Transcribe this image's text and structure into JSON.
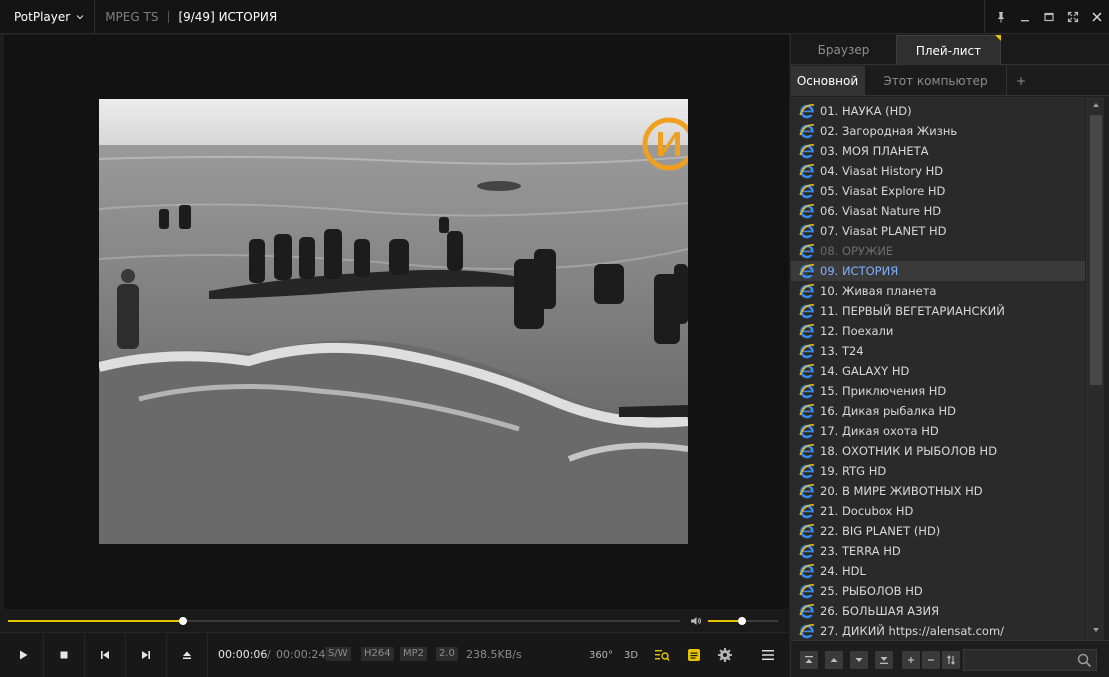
{
  "titlebar": {
    "app_name": "PotPlayer",
    "format": "MPEG TS",
    "title": "[9/49] ИСТОРИЯ"
  },
  "playback": {
    "current_time": "00:00:06",
    "separator": "/",
    "total_time": "00:00:24",
    "seek_fraction": 0.26,
    "volume_fraction": 0.48
  },
  "codec_badges": [
    "S/W",
    "H264",
    "MP2",
    "2.0"
  ],
  "bitrate": "238.5KB/s",
  "toolbar_right": {
    "deg360_label": "360°",
    "threed_label": "3D"
  },
  "panel": {
    "top_tabs": [
      "Браузер",
      "Плей-лист"
    ],
    "active_top_tab": 1,
    "sub_tabs": [
      "Основной",
      "Этот компьютер",
      "+"
    ],
    "active_sub_tab": 0,
    "playlist": [
      {
        "label": "01. НАУКА (HD)",
        "state": "normal"
      },
      {
        "label": "02. Загородная Жизнь",
        "state": "normal"
      },
      {
        "label": "03. МОЯ ПЛАНЕТА",
        "state": "normal"
      },
      {
        "label": "04. Viasat History HD",
        "state": "normal"
      },
      {
        "label": "05. Viasat Explore HD",
        "state": "normal"
      },
      {
        "label": "06. Viasat Nature HD",
        "state": "normal"
      },
      {
        "label": "07. Viasat PLANET HD",
        "state": "normal"
      },
      {
        "label": "08. ОРУЖИЕ",
        "state": "dim"
      },
      {
        "label": "09. ИСТОРИЯ",
        "state": "active"
      },
      {
        "label": "10. Живая планета",
        "state": "normal"
      },
      {
        "label": "11. ПЕРВЫЙ ВЕГЕТАРИАНСКИЙ",
        "state": "normal"
      },
      {
        "label": "12. Поехали",
        "state": "normal"
      },
      {
        "label": "13. T24",
        "state": "normal"
      },
      {
        "label": "14. GALAXY HD",
        "state": "normal"
      },
      {
        "label": "15. Приключения HD",
        "state": "normal"
      },
      {
        "label": "16. Дикая рыбалка HD",
        "state": "normal"
      },
      {
        "label": "17. Дикая охота HD",
        "state": "normal"
      },
      {
        "label": "18. ОХОТНИК И РЫБОЛОВ HD",
        "state": "normal"
      },
      {
        "label": "19. RTG HD",
        "state": "normal"
      },
      {
        "label": "20. В МИРЕ ЖИВОТНЫХ HD",
        "state": "normal"
      },
      {
        "label": "21. Docubox HD",
        "state": "normal"
      },
      {
        "label": "22. BIG PLANET (HD)",
        "state": "normal"
      },
      {
        "label": "23. TERRA HD",
        "state": "normal"
      },
      {
        "label": "24. HDL",
        "state": "normal"
      },
      {
        "label": "25. РЫБОЛОВ HD",
        "state": "normal"
      },
      {
        "label": "26. БОЛЬШАЯ АЗИЯ",
        "state": "normal"
      },
      {
        "label": "27. ДИКИЙ https://alensat.com/",
        "state": "normal"
      }
    ]
  },
  "colors": {
    "accent": "#e8c400",
    "active_item": "#7fb0ff",
    "logo": "#f0a020"
  }
}
